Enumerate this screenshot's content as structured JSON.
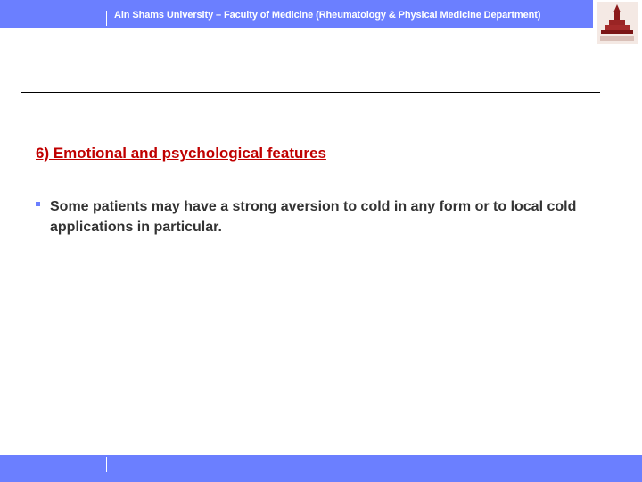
{
  "header": {
    "text": "Ain Shams University – Faculty of Medicine  (Rheumatology & Physical Medicine Department)",
    "logo_caption": "Ain Shams University",
    "accent_color": "#6b7fff"
  },
  "slide": {
    "title": "6) Emotional and psychological features",
    "title_color": "#c00000",
    "bullets": [
      "Some patients may have a strong aversion to cold in any form or to local cold applications in particular."
    ]
  },
  "icons": {
    "bullet": "square-bullet-icon",
    "logo": "university-logo-icon"
  }
}
